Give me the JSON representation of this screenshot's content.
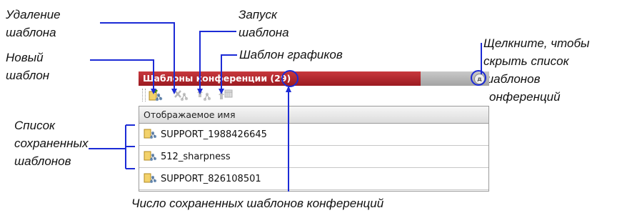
{
  "panel": {
    "title": "Шаблоны конференции (29)",
    "collapse_label": "д",
    "column_header": "Отображаемое имя",
    "toolbar": [
      "new-template-button",
      "delete-template-button",
      "launch-template-button",
      "schedule-template-button"
    ],
    "rows": [
      {
        "name": "SUPPORT_1988426645"
      },
      {
        "name": "512_sharpness"
      },
      {
        "name": "SUPPORT_826108501"
      }
    ]
  },
  "callouts": {
    "delete": [
      "Удаление",
      "шаблона"
    ],
    "new": [
      "Новый",
      "шаблон"
    ],
    "launch": [
      "Запуск",
      "шаблона"
    ],
    "schedule": [
      "Шаблон графиков"
    ],
    "hide": [
      "Щелкните, чтобы",
      "скрыть список",
      "шаблонов",
      "конференций"
    ],
    "saved_list": [
      "Список",
      "сохраненных",
      "шаблонов"
    ],
    "count": [
      "Число сохраненных шаблонов конференций"
    ]
  },
  "colors": {
    "accent_line": "#1c2bd6",
    "title_red": "#b12a30",
    "title_grey": "#b5b5b5"
  }
}
